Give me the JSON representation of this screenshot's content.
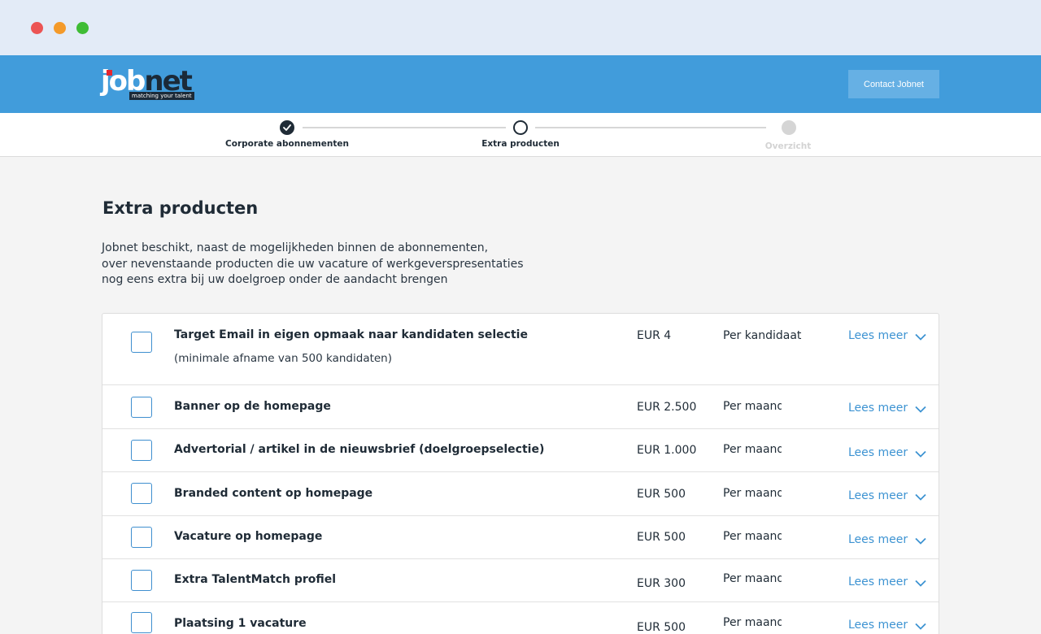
{
  "window": {
    "controls": [
      "close",
      "minimize",
      "zoom"
    ]
  },
  "header": {
    "logo_main": "job",
    "logo_accent": "net",
    "logo_tagline": "matching your talent",
    "contact_button": "Contact Jobnet"
  },
  "stepper": {
    "steps": [
      {
        "label": "Corporate abonnementen",
        "state": "done"
      },
      {
        "label": "Extra producten",
        "state": "active"
      },
      {
        "label": "Overzicht",
        "state": "pending"
      }
    ]
  },
  "page": {
    "title": "Extra producten",
    "intro_lines": [
      "Jobnet beschikt, naast de mogelijkheden binnen de abonnementen,",
      "over nevenstaande producten die uw vacature of werkgeverspresentaties",
      "nog eens extra bij uw doelgroep onder de aandacht brengen"
    ]
  },
  "products": [
    {
      "name": "Target Email in eigen opmaak naar kandidaten selectie",
      "sub": "(minimale afname van 500 kandidaten)",
      "price": "EUR 4",
      "unit": "Per kandidaat",
      "more": "Lees meer",
      "checked": false
    },
    {
      "name": "Banner op de homepage",
      "price": "EUR 2.500",
      "unit": "Per maand",
      "more": "Lees meer",
      "checked": false
    },
    {
      "name": "Advertorial / artikel in de nieuwsbrief (doelgroepselectie)",
      "price": "EUR 1.000",
      "unit": "Per maand",
      "more": "Lees meer",
      "checked": false
    },
    {
      "name": "Branded content op homepage",
      "price": "EUR 500",
      "unit": "Per maand",
      "more": "Lees meer",
      "checked": false
    },
    {
      "name": "Vacature op homepage",
      "price": "EUR 500",
      "unit": "Per maand",
      "more": "Lees meer",
      "checked": false
    },
    {
      "name": "Extra TalentMatch profiel",
      "price": "EUR 300",
      "unit": "Per maand",
      "more": "Lees meer",
      "checked": false
    },
    {
      "name": "Plaatsing 1 vacature",
      "price": "EUR 500",
      "unit": "Per maand",
      "more": "Lees meer",
      "checked": false
    }
  ],
  "colors": {
    "header_bg": "#419cdb",
    "accent_link": "#3d93d2",
    "text_dark": "#1f2b36",
    "page_bg": "#f4f4f4"
  }
}
